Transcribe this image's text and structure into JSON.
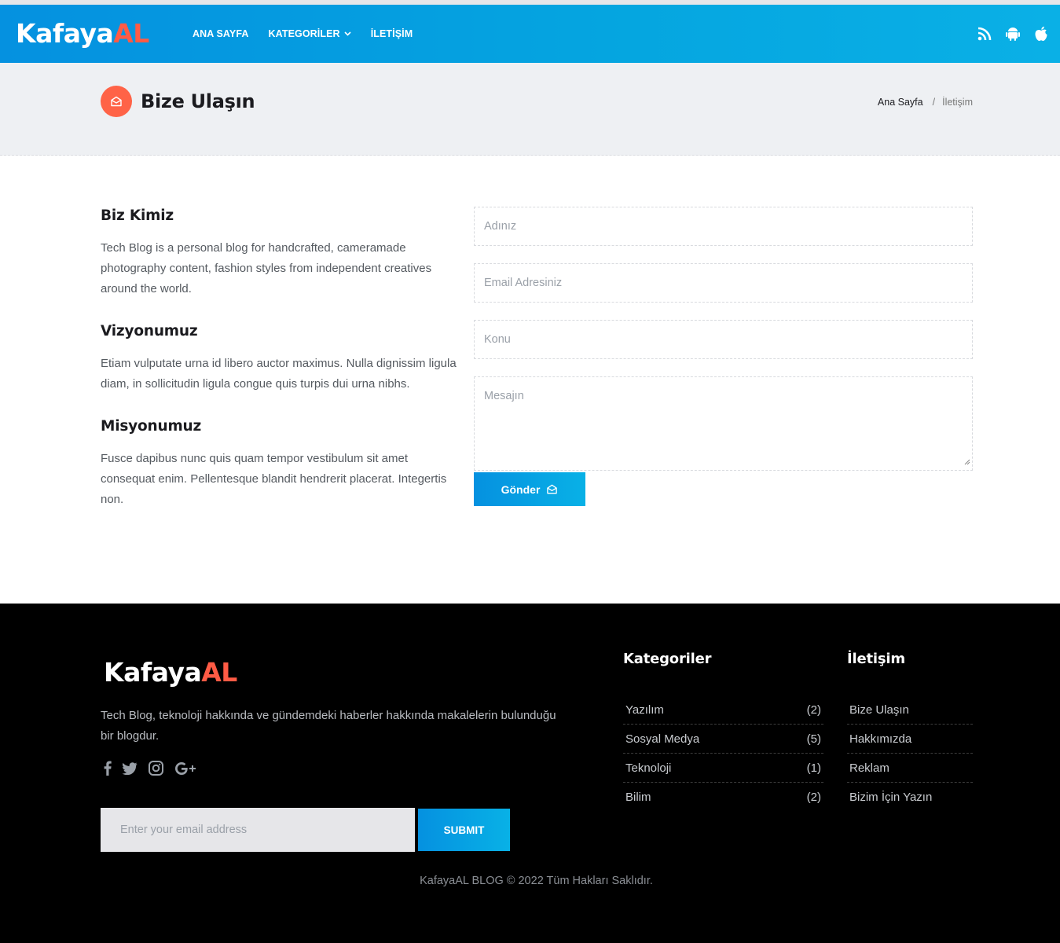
{
  "header": {
    "logo_part1": "Kafaya",
    "logo_part2": "AL",
    "nav": [
      {
        "label": "ANA SAYFA"
      },
      {
        "label": "KATEGORİLER"
      },
      {
        "label": "İLETİŞİM"
      }
    ],
    "icons": [
      "rss-icon",
      "android-icon",
      "apple-icon"
    ]
  },
  "titlebar": {
    "icon": "envelope-open-icon",
    "title": "Bize Ulaşın",
    "breadcrumb": {
      "home": "Ana Sayfa",
      "separator": "/",
      "current": "İletişim"
    }
  },
  "about": {
    "sections": [
      {
        "heading": "Biz Kimiz",
        "text": "Tech Blog is a personal blog for handcrafted, cameramade photography content, fashion styles from independent creatives around the world."
      },
      {
        "heading": "Vizyonumuz",
        "text": "Etiam vulputate urna id libero auctor maximus. Nulla dignissim ligula diam, in sollicitudin ligula congue quis turpis dui urna nibhs."
      },
      {
        "heading": "Misyonumuz",
        "text": "Fusce dapibus nunc quis quam tempor vestibulum sit amet consequat enim. Pellentesque blandit hendrerit placerat. Integertis non."
      }
    ]
  },
  "form": {
    "name_placeholder": "Adınız",
    "email_placeholder": "Email Adresiniz",
    "subject_placeholder": "Konu",
    "message_placeholder": "Mesajın",
    "send_label": "Gönder"
  },
  "footer": {
    "logo_part1": "Kafaya",
    "logo_part2": "AL",
    "description": "Tech Blog, teknoloji hakkında ve gündemdeki haberler hakkında makalelerin bulunduğu bir blogdur.",
    "social": [
      "facebook-icon",
      "twitter-icon",
      "instagram-icon",
      "google-plus-icon"
    ],
    "subscribe_placeholder": "Enter your email address",
    "submit_label": "SUBMIT",
    "categories_title": "Kategoriler",
    "categories": [
      {
        "name": "Yazılım",
        "count": "(2)"
      },
      {
        "name": "Sosyal Medya",
        "count": "(5)"
      },
      {
        "name": "Teknoloji",
        "count": "(1)"
      },
      {
        "name": "Bilim",
        "count": "(2)"
      }
    ],
    "contact_title": "İletişim",
    "contact_links": [
      {
        "label": "Bize Ulaşın"
      },
      {
        "label": "Hakkımızda"
      },
      {
        "label": "Reklam"
      },
      {
        "label": "Bizim İçin Yazın"
      }
    ],
    "copyright": "KafayaAL BLOG © 2022 Tüm Hakları Saklıdır."
  },
  "colors": {
    "brand_blue": "#0591e0",
    "accent": "#ff5b45",
    "footer_bg": "#000000"
  }
}
